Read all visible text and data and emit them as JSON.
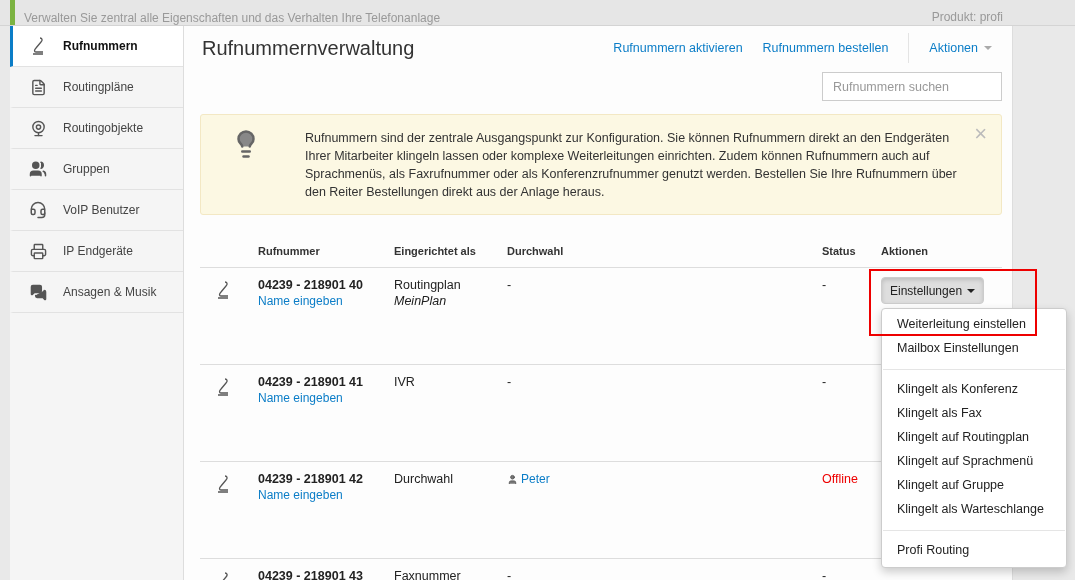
{
  "header": {
    "subtitle": "Verwalten Sie zentral alle Eigenschaften und das Verhalten Ihre Telefonanlage",
    "product": "Produkt: profi"
  },
  "sidebar": {
    "items": [
      {
        "label": "Rufnummern",
        "selected": true
      },
      {
        "label": "Routingpläne",
        "selected": false
      },
      {
        "label": "Routingobjekte",
        "selected": false
      },
      {
        "label": "Gruppen",
        "selected": false
      },
      {
        "label": "VoIP Benutzer",
        "selected": false
      },
      {
        "label": "IP Endgeräte",
        "selected": false
      },
      {
        "label": "Ansagen & Musik",
        "selected": false
      }
    ]
  },
  "toolbar": {
    "title": "Rufnummernverwaltung",
    "links": [
      "Rufnummern aktivieren",
      "Rufnummern bestellen"
    ],
    "menu": "Aktionen",
    "search": {
      "placeholder": "Rufnummern suchen"
    }
  },
  "alert": {
    "text": "Rufnummern sind der zentrale Ausgangspunkt zur Konfiguration. Sie können Rufnummern direkt an den Endgeräten Ihrer Mitarbeiter klingeln lassen oder komplexe Weiterleitungen einrichten. Zudem können Rufnummern auch auf Sprachmenüs, als Faxrufnummer oder als Konferenzrufnummer genutzt werden. Bestellen Sie Ihre Rufnummern über den Reiter Bestellungen direkt aus der Anlage heraus.",
    "close": "×"
  },
  "table": {
    "columns": [
      "Rufnummer",
      "Eingerichtet als",
      "Durchwahl",
      "Status",
      "Aktionen"
    ],
    "rows": [
      {
        "number": "04239 - 218901 40",
        "name_link": "Name eingeben",
        "type": "Routingplan",
        "type_detail": "MeinPlan",
        "extension": "-",
        "extension_user": false,
        "status": "-",
        "offline": false,
        "action": "Einstellungen",
        "open": true,
        "highlighted": true
      },
      {
        "number": "04239 - 218901 41",
        "name_link": "Name eingeben",
        "type": "IVR",
        "extension": "-",
        "extension_user": false,
        "status": "-",
        "offline": false
      },
      {
        "number": "04239 - 218901 42",
        "name_link": "Name eingeben",
        "type": "Durchwahl",
        "extension": "Peter",
        "extension_user": true,
        "status": "Offline",
        "offline": true
      },
      {
        "number": "04239 - 218901 43",
        "type": "Faxnummer",
        "extension": "-",
        "extension_user": false,
        "status": "-",
        "offline": false
      }
    ]
  },
  "dropdown": {
    "groups": [
      [
        "Weiterleitung einstellen",
        "Mailbox Einstellungen"
      ],
      [
        "Klingelt als Konferenz",
        "Klingelt als Fax",
        "Klingelt auf Routingplan",
        "Klingelt auf Sprachmenü",
        "Klingelt auf Gruppe",
        "Klingelt als Warteschlange"
      ],
      [
        "Profi Routing"
      ]
    ]
  }
}
